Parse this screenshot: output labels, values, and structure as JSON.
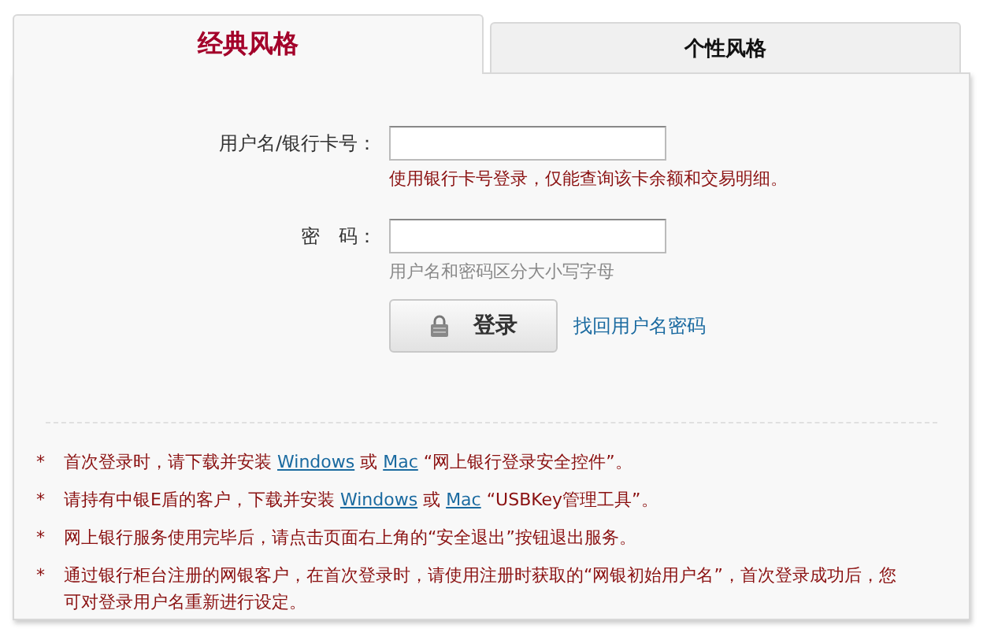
{
  "tabs": [
    {
      "label": "经典风格",
      "selected": true
    },
    {
      "label": "个性风格",
      "selected": false
    }
  ],
  "form": {
    "fields": [
      {
        "label": "用户名/银行卡号：",
        "hint": {
          "kind": "warning",
          "text": "使用银行卡号登录，仅能查询该卡余额和交易明细。"
        }
      },
      {
        "label": "密　码：",
        "hint": {
          "kind": "info",
          "text": "用户名和密码区分大小写字母"
        }
      }
    ],
    "login_button": "登录",
    "recover_link": "找回用户名密码"
  },
  "notes": [
    {
      "bullet": "*",
      "parts": [
        {
          "kind": "text",
          "text": "首次登录时，请下载并安装 "
        },
        {
          "kind": "link",
          "text": "Windows"
        },
        {
          "kind": "text",
          "text": " 或 "
        },
        {
          "kind": "link",
          "text": "Mac"
        },
        {
          "kind": "text",
          "text": " “网上银行登录安全控件”。"
        }
      ]
    },
    {
      "bullet": "*",
      "parts": [
        {
          "kind": "text",
          "text": "请持有中银E盾的客户，下载并安装 "
        },
        {
          "kind": "link",
          "text": "Windows"
        },
        {
          "kind": "text",
          "text": " 或 "
        },
        {
          "kind": "link",
          "text": "Mac"
        },
        {
          "kind": "text",
          "text": " “USBKey管理工具”。"
        }
      ]
    },
    {
      "bullet": "*",
      "parts": [
        {
          "kind": "text",
          "text": "网上银行服务使用完毕后，请点击页面右上角的“安全退出”按钮退出服务。"
        }
      ]
    },
    {
      "bullet": "*",
      "parts": [
        {
          "kind": "text",
          "text": "通过银行柜台注册的网银客户，在首次登录时，请使用注册时获取的“网银初始用户名”，首次登录成功后，您可对登录用户名重新进行设定。"
        }
      ]
    }
  ]
}
